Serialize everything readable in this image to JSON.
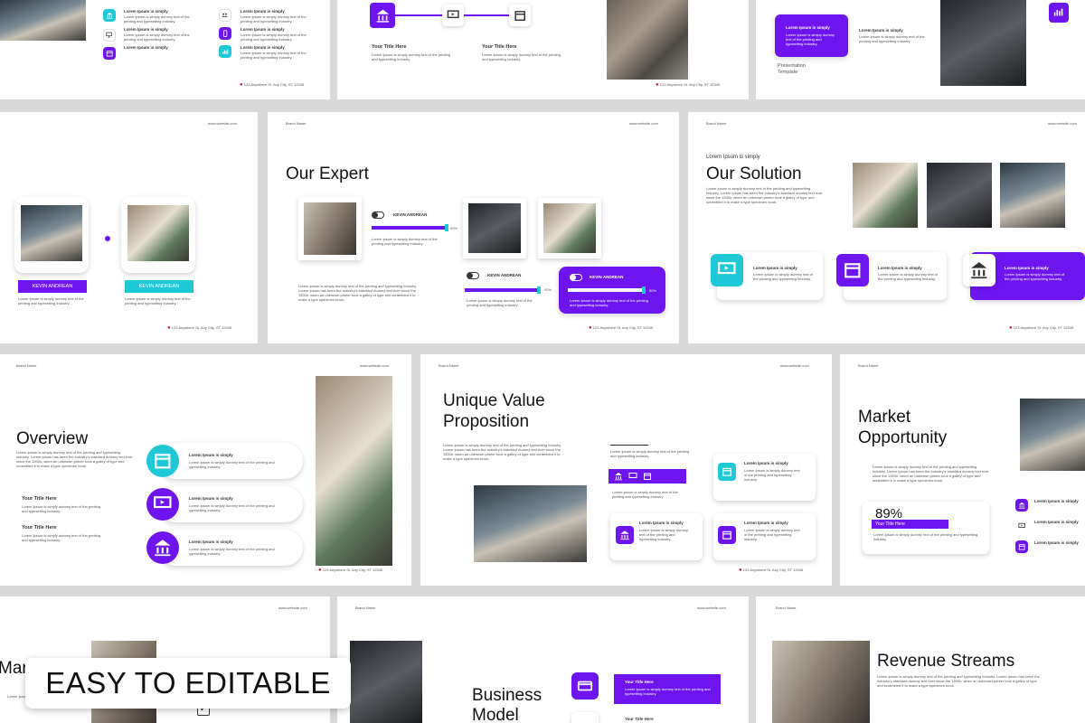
{
  "banner": "EASY TO EDITABLE",
  "common": {
    "brand": "Brand Name",
    "website": "www.website.com",
    "address": "123 Anywhere St. Any City, ST 12345",
    "lorem_simply": "Lorem Ipsum is simply",
    "lorem_short": "Lorem Ipsum is simply dummy text of the printing and typesetting industry.",
    "lorem_long": "Lorem Ipsum is simply dummy text of the printing and typesetting industry. Lorem Ipsum has been the industry's standard dummy text ever since the 1500s, when an unknown printer took a galley of type and scrambled it to make a type specimen book.",
    "your_title": "Your Title Here"
  },
  "top_row": {
    "mid_title_a": "Your Title Here",
    "mid_title_b": "Your Title Here",
    "presentation": "Presentation",
    "template": "Template"
  },
  "expert": {
    "title": "Our Expert",
    "kevin": "KEVIN ANDREAN",
    "pct": "90%"
  },
  "solution": {
    "kicker": "Lorem Ipsum is simply",
    "title": "Our Solution"
  },
  "team_left": {
    "kevin": "KEVIN ANDREAN"
  },
  "overview": {
    "title": "Overview"
  },
  "uvp": {
    "title_1": "Unique Value",
    "title_2": "Proposition"
  },
  "market": {
    "title_1": "Market",
    "title_2": "Opportunity",
    "pct": "89%",
    "partial": "Mark"
  },
  "business": {
    "title_1": "Business",
    "title_2": "Model"
  },
  "revenue": {
    "title": "Revenue Streams"
  },
  "colors": {
    "accent": "#6d14ef",
    "teal": "#1ec8d6"
  }
}
